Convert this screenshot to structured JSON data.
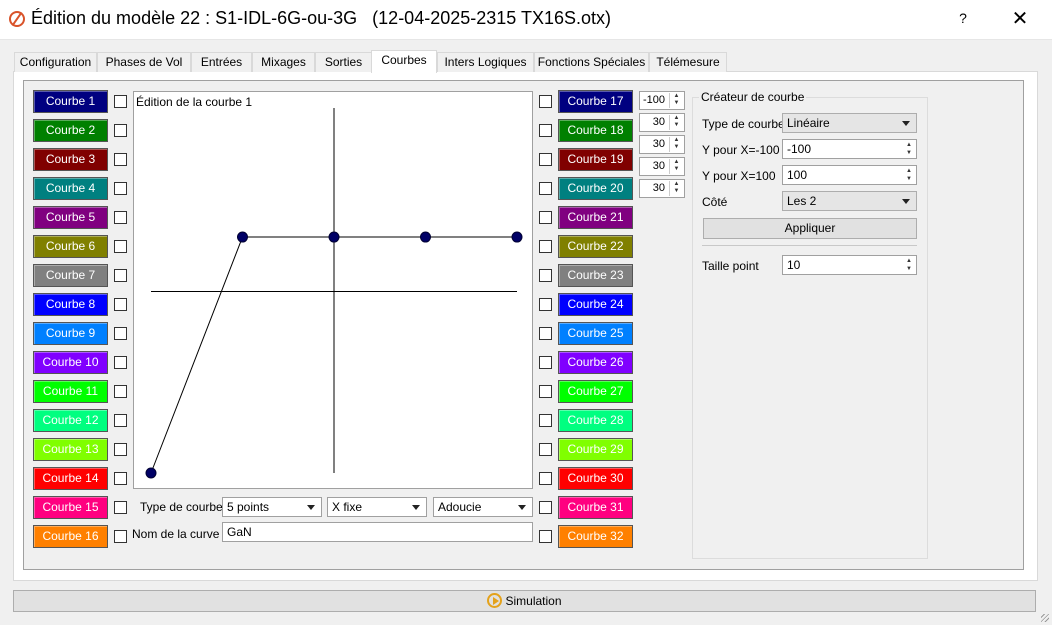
{
  "window": {
    "title": "Édition du modèle 22 : S1-IDL-6G-ou-3G   (12-04-2025-2315 TX16S.otx)",
    "help": "?",
    "close": "✕"
  },
  "tabs": [
    {
      "label": "Configuration"
    },
    {
      "label": "Phases de Vol"
    },
    {
      "label": "Entrées"
    },
    {
      "label": "Mixages"
    },
    {
      "label": "Sorties"
    },
    {
      "label": "Courbes",
      "active": true
    },
    {
      "label": "Inters Logiques"
    },
    {
      "label": "Fonctions Spéciales"
    },
    {
      "label": "Télémesure"
    }
  ],
  "curves_left": [
    {
      "label": "Courbe 1",
      "color": "#000080"
    },
    {
      "label": "Courbe 2",
      "color": "#008000"
    },
    {
      "label": "Courbe 3",
      "color": "#800000"
    },
    {
      "label": "Courbe 4",
      "color": "#008080"
    },
    {
      "label": "Courbe 5",
      "color": "#800080"
    },
    {
      "label": "Courbe 6",
      "color": "#808000"
    },
    {
      "label": "Courbe 7",
      "color": "#808080"
    },
    {
      "label": "Courbe 8",
      "color": "#0000ff"
    },
    {
      "label": "Courbe 9",
      "color": "#0080ff"
    },
    {
      "label": "Courbe 10",
      "color": "#8000ff"
    },
    {
      "label": "Courbe 11",
      "color": "#00ff00"
    },
    {
      "label": "Courbe 12",
      "color": "#00ff80"
    },
    {
      "label": "Courbe 13",
      "color": "#80ff00"
    },
    {
      "label": "Courbe 14",
      "color": "#ff0000"
    },
    {
      "label": "Courbe 15",
      "color": "#ff0080"
    },
    {
      "label": "Courbe 16",
      "color": "#ff8000"
    }
  ],
  "curves_right": [
    {
      "label": "Courbe 17",
      "color": "#000080"
    },
    {
      "label": "Courbe 18",
      "color": "#008000"
    },
    {
      "label": "Courbe 19",
      "color": "#800000"
    },
    {
      "label": "Courbe 20",
      "color": "#008080"
    },
    {
      "label": "Courbe 21",
      "color": "#800080"
    },
    {
      "label": "Courbe 22",
      "color": "#808000"
    },
    {
      "label": "Courbe 23",
      "color": "#808080"
    },
    {
      "label": "Courbe 24",
      "color": "#0000ff"
    },
    {
      "label": "Courbe 25",
      "color": "#0080ff"
    },
    {
      "label": "Courbe 26",
      "color": "#8000ff"
    },
    {
      "label": "Courbe 27",
      "color": "#00ff00"
    },
    {
      "label": "Courbe 28",
      "color": "#00ff80"
    },
    {
      "label": "Courbe 29",
      "color": "#80ff00"
    },
    {
      "label": "Courbe 30",
      "color": "#ff0000"
    },
    {
      "label": "Courbe 31",
      "color": "#ff0080"
    },
    {
      "label": "Courbe 32",
      "color": "#ff8000"
    }
  ],
  "editor": {
    "title": "Édition de la courbe 1",
    "line_color": "#000000",
    "point_color": "#000066",
    "points_y": [
      -100,
      30,
      30,
      30,
      30
    ]
  },
  "point_values": [
    "-100",
    "30",
    "30",
    "30",
    "30"
  ],
  "curve_settings": {
    "type_label": "Type de courbe",
    "type_value": "5 points",
    "x_mode": "X fixe",
    "smoothing": "Adoucie",
    "name_label": "Nom de la curve",
    "name_value": "GaN"
  },
  "creator": {
    "title": "Créateur de courbe",
    "type_label": "Type de courbe",
    "type_value": "Linéaire",
    "y_min_label": "Y pour X=-100",
    "y_min_value": "-100",
    "y_max_label": "Y pour X=100",
    "y_max_value": "100",
    "side_label": "Côté",
    "side_value": "Les 2",
    "apply": "Appliquer",
    "point_size_label": "Taille point",
    "point_size_value": "10"
  },
  "simulation": {
    "label": "Simulation"
  }
}
